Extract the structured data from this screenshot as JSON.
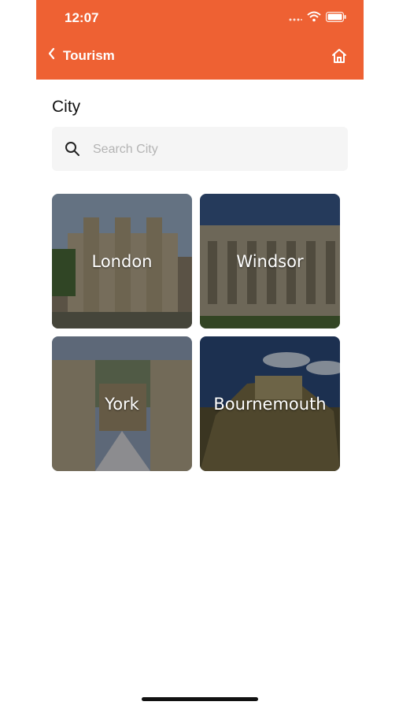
{
  "status": {
    "time": "12:07"
  },
  "header": {
    "back_label": "Tourism"
  },
  "section": {
    "title": "City"
  },
  "search": {
    "placeholder": "Search City",
    "value": ""
  },
  "cities": [
    {
      "name": "London"
    },
    {
      "name": "Windsor"
    },
    {
      "name": "York"
    },
    {
      "name": "Bournemouth"
    }
  ],
  "colors": {
    "accent": "#ee6133"
  }
}
